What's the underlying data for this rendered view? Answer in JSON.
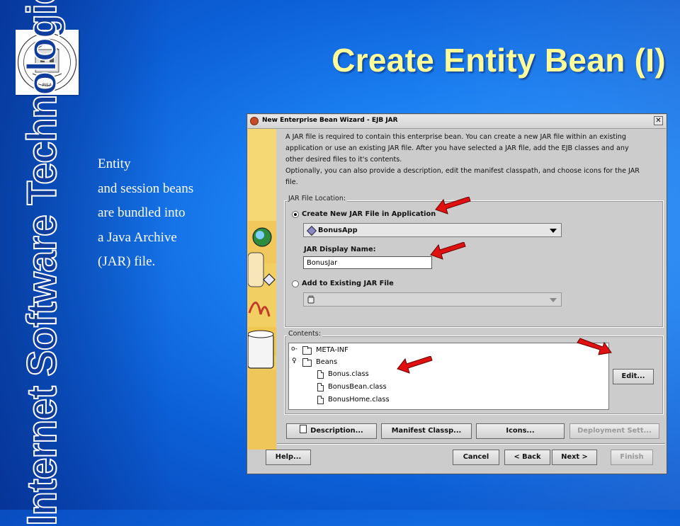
{
  "slide": {
    "title": "Create Entity Bean (I)",
    "vertical_banner": "Internet Software Technologies",
    "body_lines": [
      "Entity",
      "and session beans",
      "are bundled into",
      "a Java Archive",
      "(JAR) file."
    ],
    "logo_icon": "university-seal-icon",
    "logo_caption": "PISA"
  },
  "window": {
    "title": "New Enterprise Bean Wizard - EJB JAR",
    "description_lines": [
      "A JAR file is required to contain this enterprise bean. You can create a new JAR file within an existing",
      "application or use an existing JAR file.  After you have selected a JAR file, add the EJB classes and any",
      "other desired files to it's contents.",
      "Optionally, you can also provide a description, edit the manifest classpath, and choose icons for the JAR",
      "file."
    ],
    "jar_location": {
      "legend": "JAR File Location:",
      "create_new_label": "Create New JAR File in Application",
      "create_new_selected": true,
      "application_value": "BonusApp",
      "display_name_label": "JAR Display Name:",
      "display_name_value": "BonusJar",
      "add_existing_label": "Add to Existing JAR File",
      "add_existing_selected": false
    },
    "contents": {
      "legend": "Contents:",
      "tree": [
        {
          "label": "META-INF",
          "type": "folder",
          "expanded": false
        },
        {
          "label": "Beans",
          "type": "folder",
          "expanded": true
        },
        {
          "label": "Bonus.class",
          "type": "file"
        },
        {
          "label": "BonusBean.class",
          "type": "file"
        },
        {
          "label": "BonusHome.class",
          "type": "file"
        }
      ],
      "edit_button": "Edit..."
    },
    "action_buttons": {
      "description": "Description...",
      "manifest": "Manifest Classp...",
      "icons": "Icons...",
      "deployment": "Deployment Sett..."
    },
    "footer_buttons": {
      "help": "Help...",
      "cancel": "Cancel",
      "back": "< Back",
      "next": "Next >",
      "finish": "Finish"
    }
  },
  "colors": {
    "title": "#ffff99",
    "annotation_arrow": "#e01010"
  }
}
